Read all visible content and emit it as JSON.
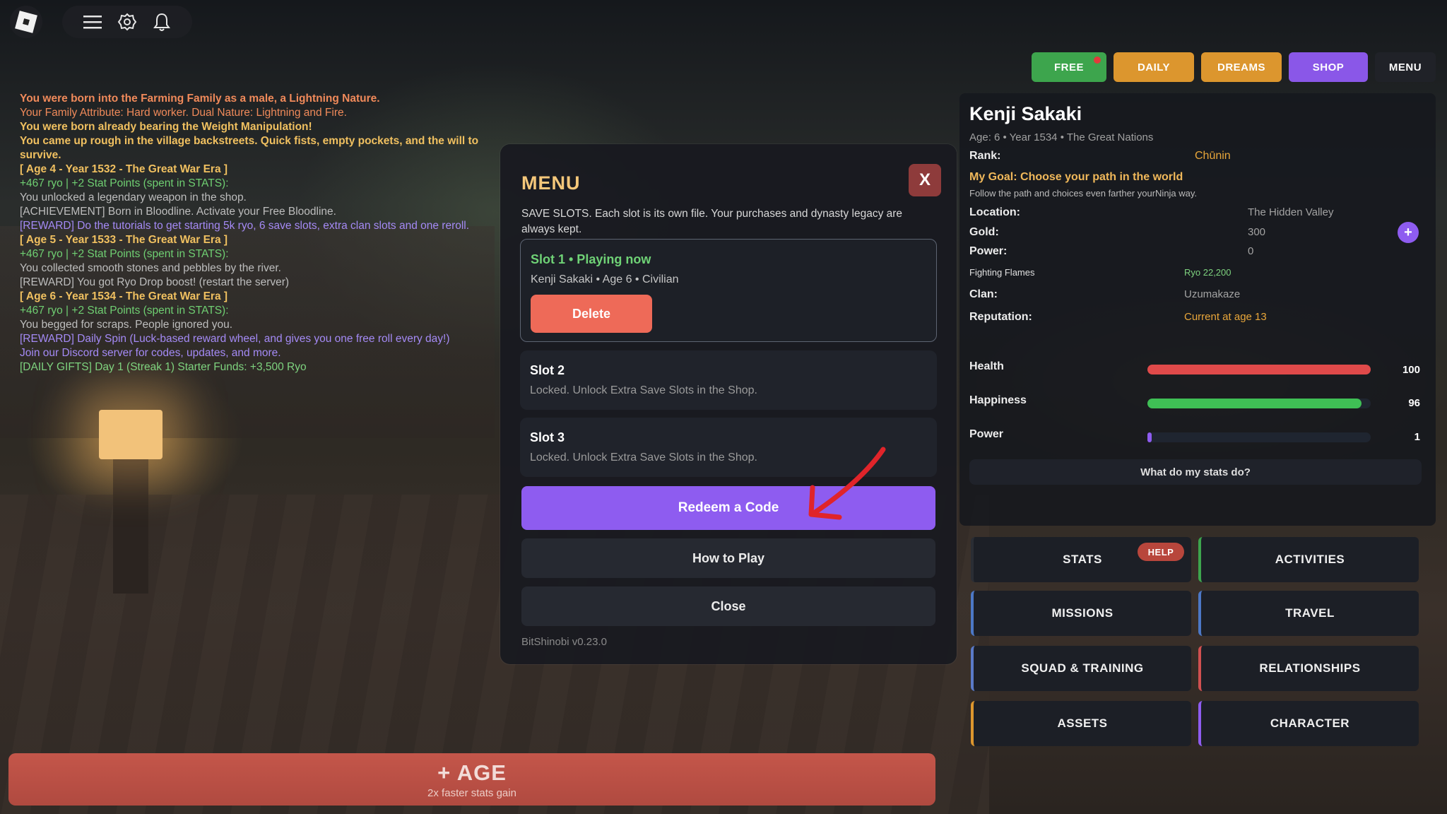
{
  "topnav": {
    "free": "FREE",
    "daily": "DAILY",
    "dreams": "DREAMS",
    "shop": "SHOP",
    "menu": "MENU"
  },
  "log": [
    {
      "text": "You were born into the Farming Family as a male, a Lightning Nature.",
      "style": "orange"
    },
    {
      "text": "Your Family Attribute: Hard worker. Dual Nature: Lightning and Fire.",
      "style": "orange-n"
    },
    {
      "text": "You were born already bearing the Weight Manipulation!",
      "style": "gold"
    },
    {
      "text": "You came up rough in the village backstreets. Quick fists, empty pockets, and the will to survive.",
      "style": "gold"
    },
    {
      "text": "[ Age 4 - Year 1532 - The Great War Era ]",
      "style": "gold"
    },
    {
      "text": "+467 ryo | +2 Stat Points (spent in STATS):",
      "style": "green"
    },
    {
      "text": "You unlocked a legendary weapon in the shop.",
      "style": "gray"
    },
    {
      "text": "[ACHIEVEMENT] Born in Bloodline. Activate your Free Bloodline.",
      "style": "gray"
    },
    {
      "text": "[REWARD] Do the tutorials to get starting 5k ryo, 6 save slots, extra clan slots and one reroll.",
      "style": "purple"
    },
    {
      "text": "[ Age 5 - Year 1533 - The Great War Era ]",
      "style": "gold"
    },
    {
      "text": "+467 ryo | +2 Stat Points (spent in STATS):",
      "style": "green"
    },
    {
      "text": "You collected smooth stones and pebbles by the river.",
      "style": "gray"
    },
    {
      "text": "[REWARD] You got Ryo Drop boost! (restart the server)",
      "style": "gray"
    },
    {
      "text": "[ Age 6 - Year 1534 - The Great War Era ]",
      "style": "gold"
    },
    {
      "text": "+467 ryo | +2 Stat Points (spent in STATS):",
      "style": "green"
    },
    {
      "text": "You begged for scraps. People ignored you.",
      "style": "gray"
    },
    {
      "text": "[REWARD] Daily Spin (Luck-based reward wheel, and gives you one free roll every day!)",
      "style": "purple"
    },
    {
      "text": "Join our Discord server for codes, updates, and more.",
      "style": "purple"
    },
    {
      "text": "[DAILY GIFTS] Day 1 (Streak 1) Starter Funds: +3,500 Ryo",
      "style": "lgreen"
    }
  ],
  "modal": {
    "title": "MENU",
    "close": "X",
    "description": "SAVE SLOTS. Each slot is its own file. Your purchases and dynasty legacy are always kept.",
    "slot1": {
      "title": "Slot 1  •  Playing now",
      "sub": "Kenji Sakaki  •  Age 6  •  Civilian",
      "delete": "Delete"
    },
    "slot2": {
      "title": "Slot 2",
      "sub": "Locked. Unlock Extra Save Slots in the Shop."
    },
    "slot3": {
      "title": "Slot 3",
      "sub": "Locked. Unlock Extra Save Slots in the Shop."
    },
    "redeem": "Redeem a Code",
    "howto": "How to Play",
    "close_label": "Close",
    "version": "BitShinobi  v0.23.0"
  },
  "profile": {
    "name": "Kenji Sakaki",
    "age_line": "Age: 6  •  Year 1534  •  The Great Nations",
    "rank_label": "Rank:",
    "rank": "Chūnin",
    "goal": "My Goal: Choose your path in the world",
    "goal_sub": "Follow the path and choices even farther yourNinja way.",
    "location_label": "Location:",
    "location": "The Hidden Valley",
    "gold_label": "Gold:",
    "gold": "300",
    "power_label": "Power:",
    "power": "0",
    "flames_label": "Fighting Flames",
    "flames": "Ryo 22,200",
    "clan_label": "Clan:",
    "clan": "Uzumakaze",
    "rep_label": "Reputation:",
    "rep": "Current at age 13",
    "health_label": "Health",
    "health": "100",
    "happiness_label": "Happiness",
    "happiness": "96",
    "powerbar_label": "Power",
    "powerbar": "1",
    "health_fill": 1.0,
    "happiness_fill": 0.96,
    "power_fill": 0.02,
    "what_stats": "What do my stats do?"
  },
  "nav": {
    "stats": "STATS",
    "help": "HELP",
    "activities": "ACTIVITIES",
    "missions": "MISSIONS",
    "travel": "TRAVEL",
    "squad": "SQUAD & TRAINING",
    "relationships": "RELATIONSHIPS",
    "assets": "ASSETS",
    "character": "CHARACTER"
  },
  "age_button": {
    "label": "+ AGE",
    "sub": "2x faster stats gain"
  },
  "colors": {
    "accent": "#8e5cf0",
    "free": "#3da54d",
    "daily": "#dc962e",
    "health": "#e04a4a",
    "happiness": "#3fbf55",
    "power": "#8e5cf0"
  },
  "icons": [
    "roblox-logo-icon",
    "hamburger-menu-icon",
    "settings-gear-icon",
    "bell-icon",
    "close-icon",
    "plus-icon",
    "red-arrow-icon"
  ]
}
